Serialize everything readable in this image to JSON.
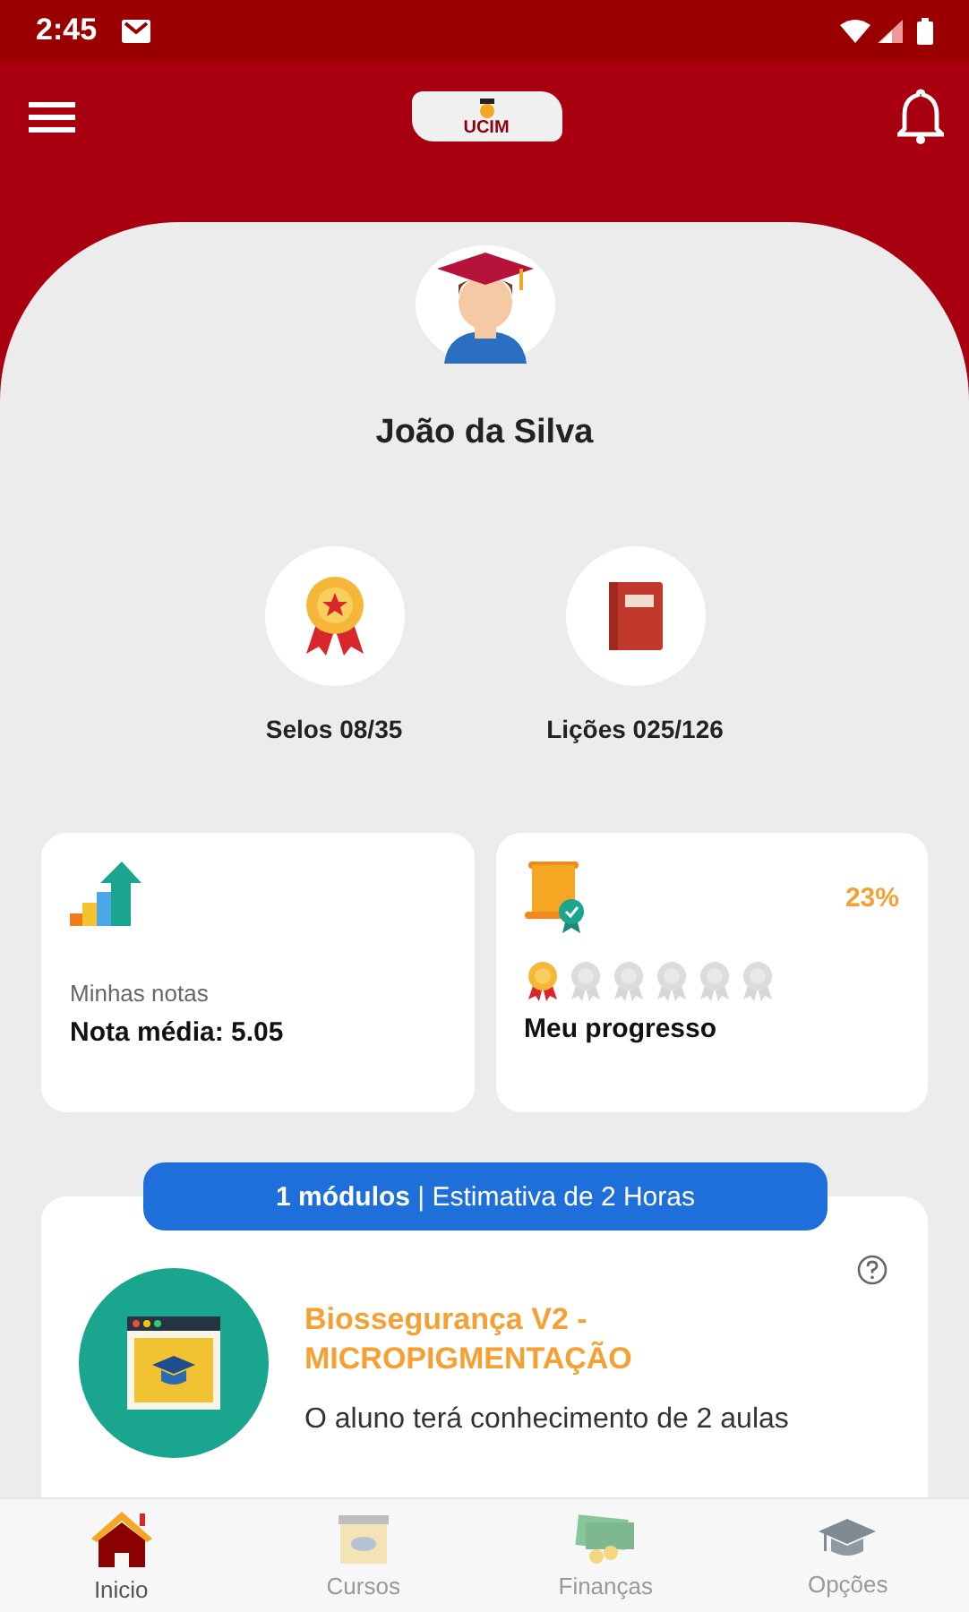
{
  "status_bar": {
    "time": "2:45"
  },
  "app_bar": {
    "logo_text": "UCIM"
  },
  "profile": {
    "name": "João da Silva"
  },
  "stats": [
    {
      "kind": "seals",
      "label": "Selos 08/35"
    },
    {
      "kind": "lessons",
      "label": "Lições 025/126"
    }
  ],
  "grades_card": {
    "caption": "Minhas notas",
    "average": "Nota média: 5.05"
  },
  "progress_card": {
    "percent": "23%",
    "label": "Meu progresso",
    "medals": [
      {
        "earned": true
      },
      {
        "earned": false
      },
      {
        "earned": false
      },
      {
        "earned": false
      },
      {
        "earned": false
      },
      {
        "earned": false
      }
    ]
  },
  "course": {
    "summary": "**1 módulos** | Estimativa de 2 Horas",
    "title": "Biossegurança V2 - MICROPIGMENTAÇÃO",
    "description": "O aluno terá conhecimento de 2 aulas"
  },
  "bottom_nav": [
    {
      "kind": "home",
      "label": "Inicio",
      "selected": true
    },
    {
      "kind": "courses",
      "label": "Cursos",
      "selected": false
    },
    {
      "kind": "finance",
      "label": "Finanças",
      "selected": false
    },
    {
      "kind": "options",
      "label": "Opções",
      "selected": false
    }
  ]
}
